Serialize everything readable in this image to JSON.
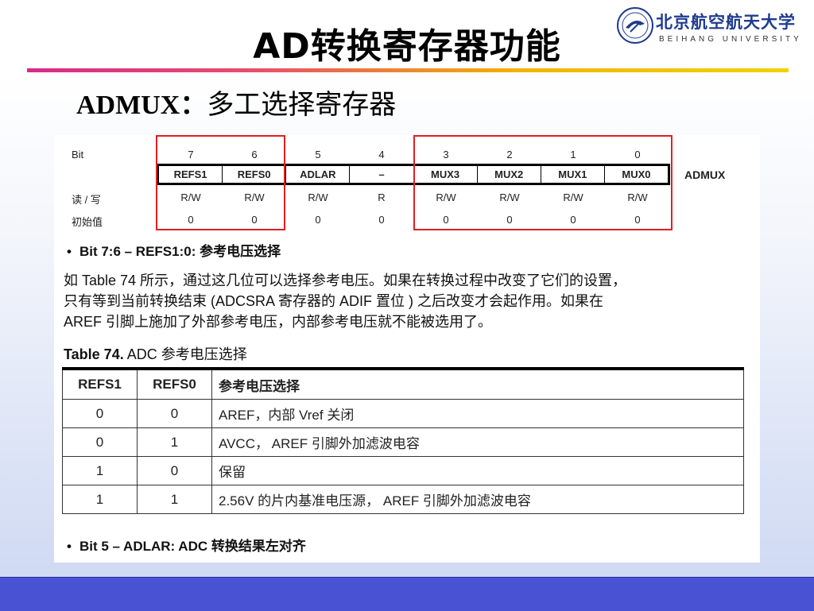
{
  "slide": {
    "title": "AD转换寄存器功能",
    "subtitle_bold": "ADMUX",
    "subtitle_sep": "：",
    "subtitle_text": "多工选择寄存器"
  },
  "logo": {
    "cn": "北京航空航天大学",
    "en": "BEIHANG UNIVERSITY",
    "colors": {
      "primary": "#1f3b8f"
    }
  },
  "register": {
    "name": "ADMUX",
    "bit_label": "Bit",
    "rw_label": "读 / 写",
    "init_label": "初始值",
    "bits": [
      "7",
      "6",
      "5",
      "4",
      "3",
      "2",
      "1",
      "0"
    ],
    "fields": [
      "REFS1",
      "REFS0",
      "ADLAR",
      "–",
      "MUX3",
      "MUX2",
      "MUX1",
      "MUX0"
    ],
    "rw": [
      "R/W",
      "R/W",
      "R/W",
      "R",
      "R/W",
      "R/W",
      "R/W",
      "R/W"
    ],
    "init": [
      "0",
      "0",
      "0",
      "0",
      "0",
      "0",
      "0",
      "0"
    ]
  },
  "section1": {
    "heading": "Bit 7:6 – REFS1:0: 参考电压选择",
    "line1": "如 Table 74 所示，通过这几位可以选择参考电压。如果在转换过程中改变了它们的设置，",
    "line2": "只有等到当前转换结束 (ADCSRA 寄存器的 ADIF 置位 ) 之后改变才会起作用。如果在",
    "line3": "AREF 引脚上施加了外部参考电压，内部参考电压就不能被选用了。"
  },
  "table74": {
    "caption_bold": "Table 74.",
    "caption_text": "ADC 参考电压选择",
    "headers": [
      "REFS1",
      "REFS0",
      "参考电压选择"
    ],
    "rows": [
      [
        "0",
        "0",
        "AREF，内部 Vref 关闭"
      ],
      [
        "0",
        "1",
        "AVCC， AREF 引脚外加滤波电容"
      ],
      [
        "1",
        "0",
        "保留"
      ],
      [
        "1",
        "1",
        "2.56V 的片内基准电压源， AREF 引脚外加滤波电容"
      ]
    ]
  },
  "section2": {
    "heading": "Bit 5 – ADLAR: ADC 转换结果左对齐"
  },
  "colors": {
    "highlight_box": "#e02020",
    "footer_bar": "#4a52d4"
  }
}
